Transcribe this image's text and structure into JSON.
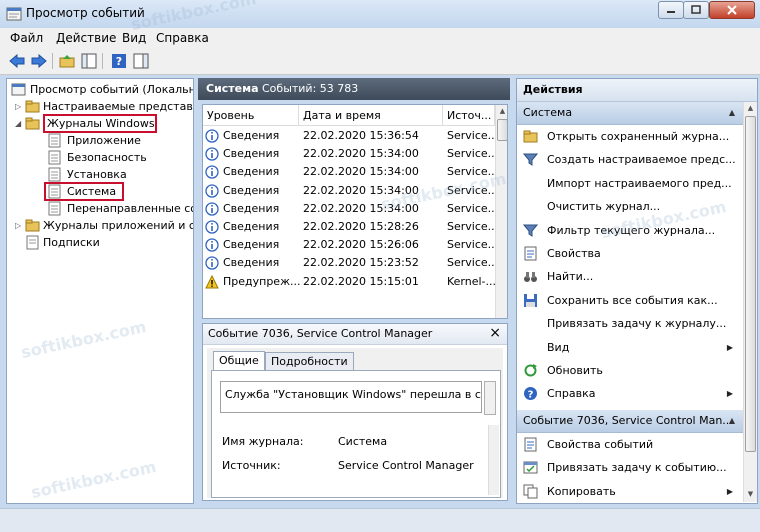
{
  "window": {
    "title": "Просмотр событий"
  },
  "menu": [
    "Файл",
    "Действие",
    "Вид",
    "Справка"
  ],
  "tree": {
    "items": [
      {
        "label": "Просмотр событий (Локальны"
      },
      {
        "label": "Настраиваемые представле"
      },
      {
        "label": "Журналы Windows"
      },
      {
        "label": "Приложение"
      },
      {
        "label": "Безопасность"
      },
      {
        "label": "Установка"
      },
      {
        "label": "Система"
      },
      {
        "label": "Перенаправленные соб"
      },
      {
        "label": "Журналы приложений и сл"
      },
      {
        "label": "Подписки"
      }
    ]
  },
  "events": {
    "header_title": "Система",
    "header_count": "Событий: 53 783",
    "columns": [
      "Уровень",
      "Дата и время",
      "Источ..."
    ],
    "rows": [
      {
        "level": "Сведения",
        "date": "22.02.2020 15:36:54",
        "source": "Service..."
      },
      {
        "level": "Сведения",
        "date": "22.02.2020 15:34:00",
        "source": "Service..."
      },
      {
        "level": "Сведения",
        "date": "22.02.2020 15:34:00",
        "source": "Service..."
      },
      {
        "level": "Сведения",
        "date": "22.02.2020 15:34:00",
        "source": "Service..."
      },
      {
        "level": "Сведения",
        "date": "22.02.2020 15:34:00",
        "source": "Service..."
      },
      {
        "level": "Сведения",
        "date": "22.02.2020 15:28:26",
        "source": "Service..."
      },
      {
        "level": "Сведения",
        "date": "22.02.2020 15:26:06",
        "source": "Service..."
      },
      {
        "level": "Сведения",
        "date": "22.02.2020 15:23:52",
        "source": "Service..."
      },
      {
        "level": "Предупреж...",
        "date": "22.02.2020 15:15:01",
        "source": "Kernel-..."
      }
    ]
  },
  "detail": {
    "title": "Событие 7036, Service Control Manager",
    "tabs": [
      "Общие",
      "Подробности"
    ],
    "description": "Служба \"Установщик Windows\" перешла в сост",
    "fields": [
      {
        "label": "Имя журнала:",
        "value": "Система"
      },
      {
        "label": "Источник:",
        "value": "Service Control Manager"
      }
    ]
  },
  "actions": {
    "header": "Действия",
    "section1": "Система",
    "items1": [
      {
        "label": "Открыть сохраненный журна...",
        "icon": "folder-open-icon"
      },
      {
        "label": "Создать настраиваемое предс...",
        "icon": "filter-icon"
      },
      {
        "label": "Импорт настраиваемого пред...",
        "icon": ""
      },
      {
        "label": "Очистить журнал...",
        "icon": ""
      },
      {
        "label": "Фильтр текущего журнала...",
        "icon": "filter-icon"
      },
      {
        "label": "Свойства",
        "icon": "properties-icon"
      },
      {
        "label": "Найти...",
        "icon": "binoculars-icon"
      },
      {
        "label": "Сохранить все события как...",
        "icon": "save-icon"
      },
      {
        "label": "Привязать задачу к журналу...",
        "icon": ""
      },
      {
        "label": "Вид",
        "icon": "",
        "submenu": true
      },
      {
        "label": "Обновить",
        "icon": "refresh-icon"
      },
      {
        "label": "Справка",
        "icon": "help-icon",
        "submenu": true
      }
    ],
    "section2": "Событие 7036, Service Control Man...",
    "items2": [
      {
        "label": "Свойства событий",
        "icon": "properties-icon"
      },
      {
        "label": "Привязать задачу к событию...",
        "icon": "task-icon"
      },
      {
        "label": "Копировать",
        "icon": "copy-icon",
        "submenu": true
      }
    ]
  },
  "watermark": "softikbox.com"
}
